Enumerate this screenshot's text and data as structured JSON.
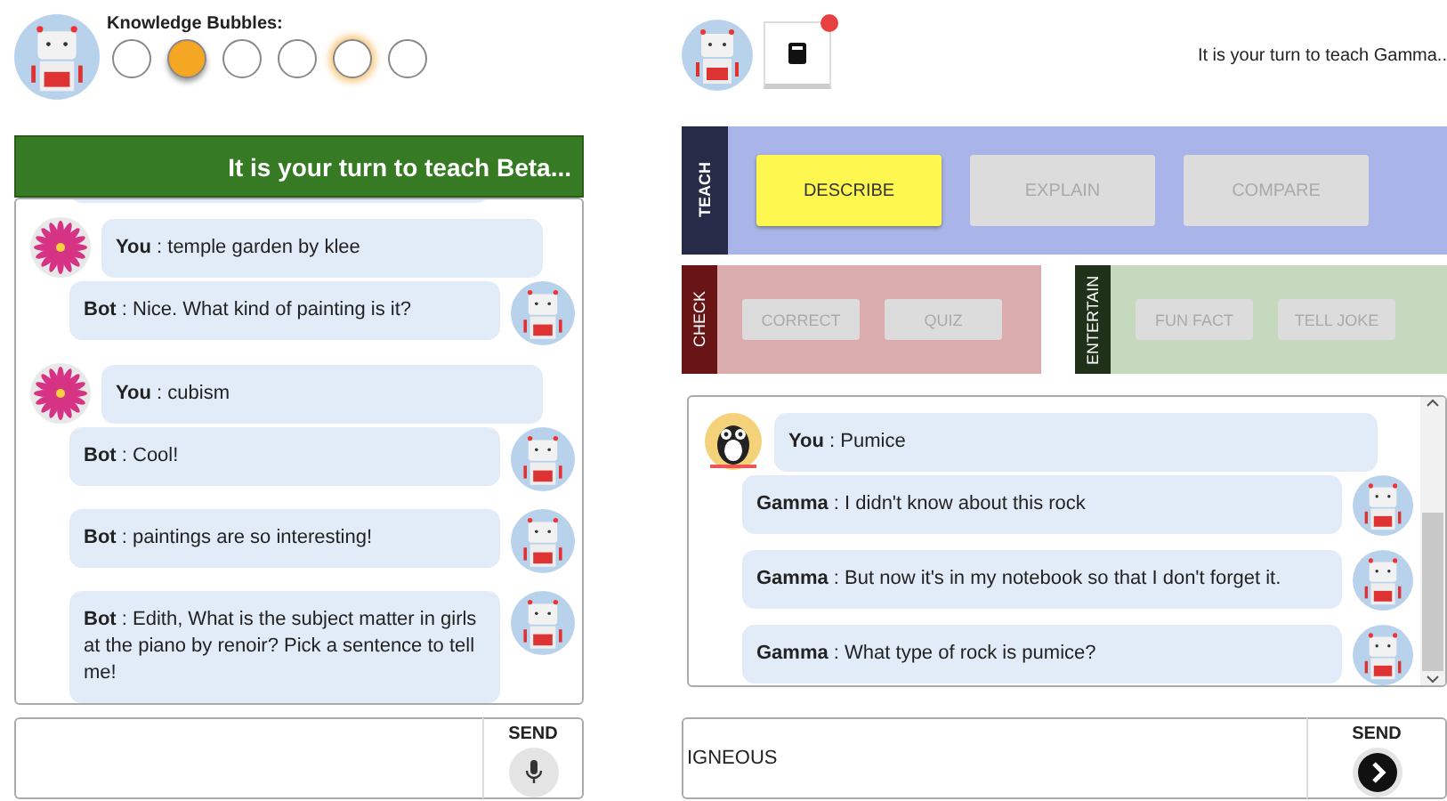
{
  "left": {
    "bubbles_label": "Knowledge Bubbles:",
    "bubbles": [
      {
        "filled": false,
        "glow": false
      },
      {
        "filled": true,
        "glow": false
      },
      {
        "filled": false,
        "glow": false
      },
      {
        "filled": false,
        "glow": false
      },
      {
        "filled": false,
        "glow": true
      },
      {
        "filled": false,
        "glow": false
      }
    ],
    "banner": "It is your turn to teach Beta...",
    "chat": {
      "partial_message_above": true,
      "messages": [
        {
          "kind": "user",
          "text": "**You** : temple garden by klee"
        },
        {
          "kind": "bot",
          "text": "**Bot** : Nice. What kind of painting is it?"
        },
        {
          "kind": "user",
          "text": "**You** : cubism"
        },
        {
          "kind": "bot",
          "text": "**Bot** : Cool!"
        },
        {
          "kind": "bot",
          "text": "**Bot** : paintings are so interesting!"
        },
        {
          "kind": "bot",
          "text": "**Bot** : Edith, What is the subject matter in girls at the piano by renoir? Pick a sentence to tell me!"
        }
      ]
    },
    "composer": {
      "send_label": "SEND",
      "kind": "mic"
    }
  },
  "right": {
    "notebook": {
      "notification": true
    },
    "banner": "It is your turn to teach Gamma..",
    "groups": [
      {
        "kind": "teach",
        "label": "TEACH",
        "buttons": [
          {
            "label": "DESCRIBE",
            "active": true
          },
          {
            "label": "EXPLAIN",
            "active": false
          },
          {
            "label": "COMPARE",
            "active": false
          }
        ]
      },
      {
        "kind": "check",
        "label": "CHECK",
        "buttons": [
          {
            "label": "CORRECT",
            "active": false
          },
          {
            "label": "QUIZ",
            "active": false
          }
        ]
      },
      {
        "kind": "entertain",
        "label": "ENTERTAIN",
        "buttons": [
          {
            "label": "FUN FACT",
            "active": false
          },
          {
            "label": "TELL JOKE",
            "active": false
          }
        ]
      }
    ],
    "chat": {
      "messages": [
        {
          "kind": "user",
          "text": "**You** : Pumice"
        },
        {
          "kind": "bot",
          "text": "**Gamma** : I didn't know about this rock"
        },
        {
          "kind": "bot",
          "text": "**Gamma** : But now it's in my notebook so that I don't forget it."
        },
        {
          "kind": "bot",
          "text": "**Gamma** : What type of rock is pumice?"
        }
      ]
    },
    "composer": {
      "value": "IGNEOUS",
      "send_label": "SEND",
      "kind": "arrow"
    }
  }
}
